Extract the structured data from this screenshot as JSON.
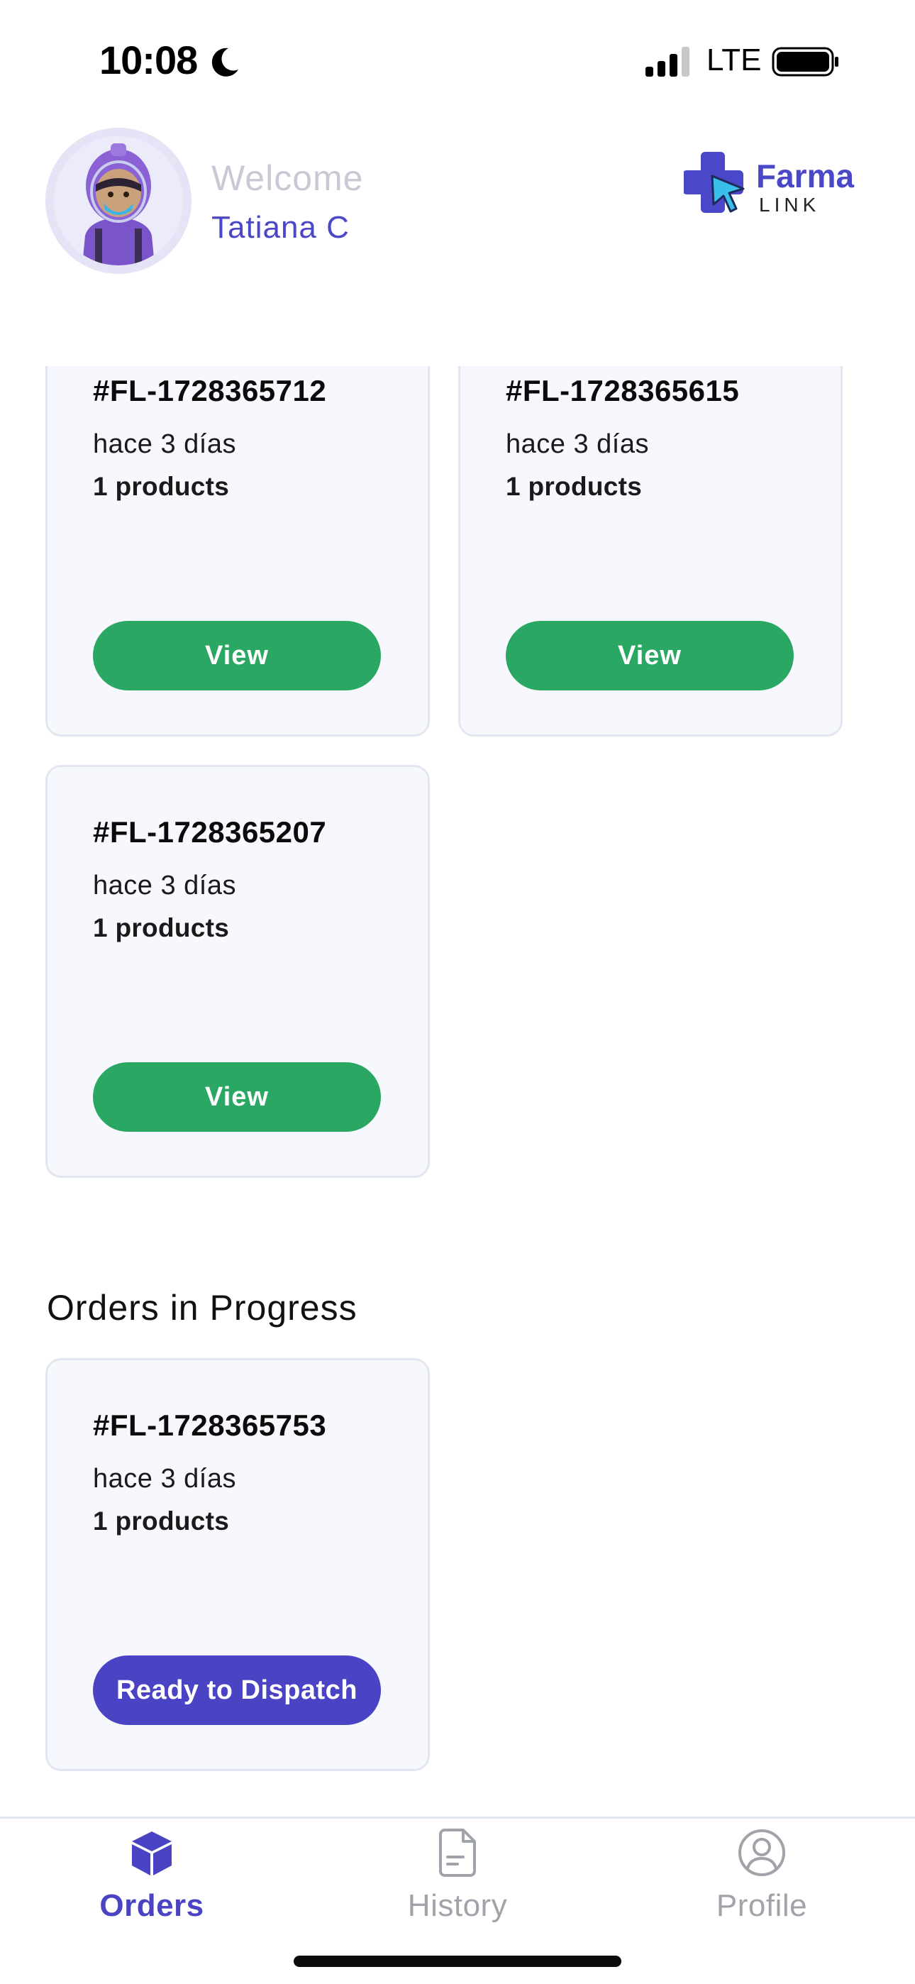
{
  "status_bar": {
    "time": "10:08",
    "network": "LTE",
    "icons": [
      "moon-icon",
      "signal-icon",
      "battery-icon"
    ]
  },
  "header": {
    "welcome": "Welcome",
    "user_name": "Tatiana C",
    "avatar_icon": "avatar",
    "logo": {
      "text_primary": "Farma",
      "text_secondary": "LINK"
    }
  },
  "orders": [
    {
      "id": "#FL-1728365712",
      "time": "hace 3 días",
      "products": "1 products",
      "action_label": "View"
    },
    {
      "id": "#FL-1728365615",
      "time": "hace 3 días",
      "products": "1 products",
      "action_label": "View"
    },
    {
      "id": "#FL-1728365207",
      "time": "hace 3 días",
      "products": "1 products",
      "action_label": "View"
    }
  ],
  "in_progress": {
    "title": "Orders in Progress",
    "orders": [
      {
        "id": "#FL-1728365753",
        "time": "hace 3 días",
        "products": "1 products",
        "action_label": "Ready to Dispatch"
      }
    ]
  },
  "tabs": [
    {
      "label": "Orders",
      "icon": "cube-icon",
      "active": true
    },
    {
      "label": "History",
      "icon": "document-icon",
      "active": false
    },
    {
      "label": "Profile",
      "icon": "user-circle-icon",
      "active": false
    }
  ],
  "colors": {
    "primary": "#4a43c4",
    "success": "#2aa863",
    "card_bg": "#f7f8fd",
    "card_border": "#e2e6f1",
    "muted": "#a0a3aa"
  }
}
